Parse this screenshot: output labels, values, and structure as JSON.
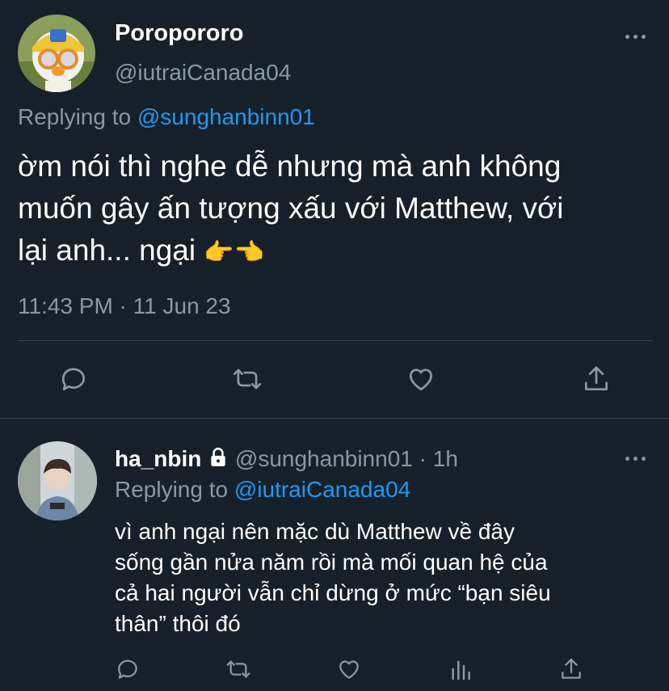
{
  "tweet": {
    "display_name": "Poropororo",
    "handle": "@iutraiCanada04",
    "replying_to_label": "Replying to",
    "replying_to_handle": "@sunghanbinn01",
    "text_line1": "ờm nói thì nghe dễ nhưng mà anh không",
    "text_line2": "muốn gây ấn tượng xấu với Matthew, với",
    "text_line3": "lại anh... ngại",
    "emoji": "👉👈",
    "timestamp": "11:43 PM · 11 Jun 23"
  },
  "reply": {
    "display_name": "ha_nbin",
    "handle": "@sunghanbinn01",
    "time": "· 1h",
    "replying_to_label": "Replying to",
    "replying_to_handle": "@iutraiCanada04",
    "text_line1": "vì anh ngại nên mặc dù Matthew về đây",
    "text_line2": "sống gần nửa năm rồi mà mối quan hệ của",
    "text_line3": "cả hai người vẫn chỉ dừng ở mức “bạn siêu",
    "text_line4": "thân” thôi đó"
  },
  "icons": {
    "reply": "reply-icon",
    "retweet": "retweet-icon",
    "like": "like-icon",
    "share": "share-icon",
    "analytics": "analytics-icon",
    "more": "more-icon",
    "lock": "lock-icon"
  },
  "colors": {
    "background": "#15202b",
    "text": "#ffffff",
    "muted": "#8899a6",
    "link": "#1d9bf0"
  }
}
